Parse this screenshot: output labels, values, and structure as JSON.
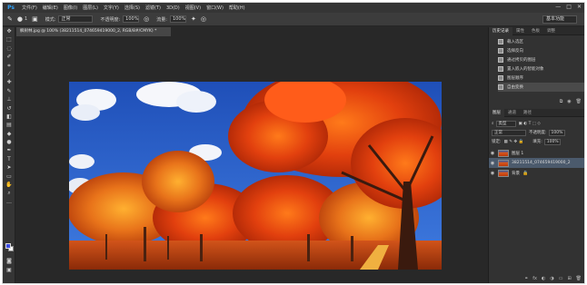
{
  "app": {
    "logo": "Ps"
  },
  "menu": [
    "文件(F)",
    "编辑(E)",
    "图像(I)",
    "图层(L)",
    "文字(Y)",
    "选择(S)",
    "滤镜(T)",
    "3D(D)",
    "视图(V)",
    "窗口(W)",
    "帮助(H)"
  ],
  "window_controls": {
    "minimize": "—",
    "maximize": "□",
    "close": "✕"
  },
  "options": {
    "brush_size": "1",
    "mode_label": "模式:",
    "mode_value": "正常",
    "opacity_label": "不透明度:",
    "opacity_value": "100%",
    "flow_label": "流量:",
    "flow_value": "100%",
    "workspace": "基本功能"
  },
  "document": {
    "tab_title": "枫树林.jpg @ 100% (38211514_074659419000_2, RGB/8#/CMYK) *"
  },
  "history_panel": {
    "tabs": [
      "历史记录",
      "属性",
      "色板",
      "调整"
    ],
    "items": [
      "载入选区",
      "选择反向",
      "通过拷贝的图层",
      "置入嵌入的智能对象",
      "图层顺序",
      "自由变换"
    ],
    "selected_index": 5
  },
  "layers_panel": {
    "tabs": [
      "图层",
      "通道",
      "路径"
    ],
    "filter_label": "类型",
    "blend_mode": "正常",
    "opacity_label": "不透明度:",
    "opacity_value": "100%",
    "lock_label": "锁定:",
    "fill_label": "填充:",
    "fill_value": "100%",
    "layers": [
      {
        "name": "图层 1",
        "visible": true,
        "selected": false
      },
      {
        "name": "38211514_074659419000_2",
        "visible": true,
        "selected": true
      },
      {
        "name": "背景",
        "visible": true,
        "selected": false,
        "locked": true
      }
    ]
  },
  "tool_icons": [
    "move-icon",
    "marquee-icon",
    "lasso-icon",
    "quick-select-icon",
    "crop-icon",
    "eyedropper-icon",
    "healing-icon",
    "brush-icon",
    "stamp-icon",
    "history-brush-icon",
    "eraser-icon",
    "gradient-icon",
    "blur-icon",
    "dodge-icon",
    "pen-icon",
    "type-icon",
    "path-select-icon",
    "shape-icon",
    "hand-icon",
    "zoom-icon",
    "more-icon"
  ],
  "colors": {
    "foreground": "#3c4ce0",
    "background": "#ffffff",
    "accent": "#2fa4ff"
  }
}
